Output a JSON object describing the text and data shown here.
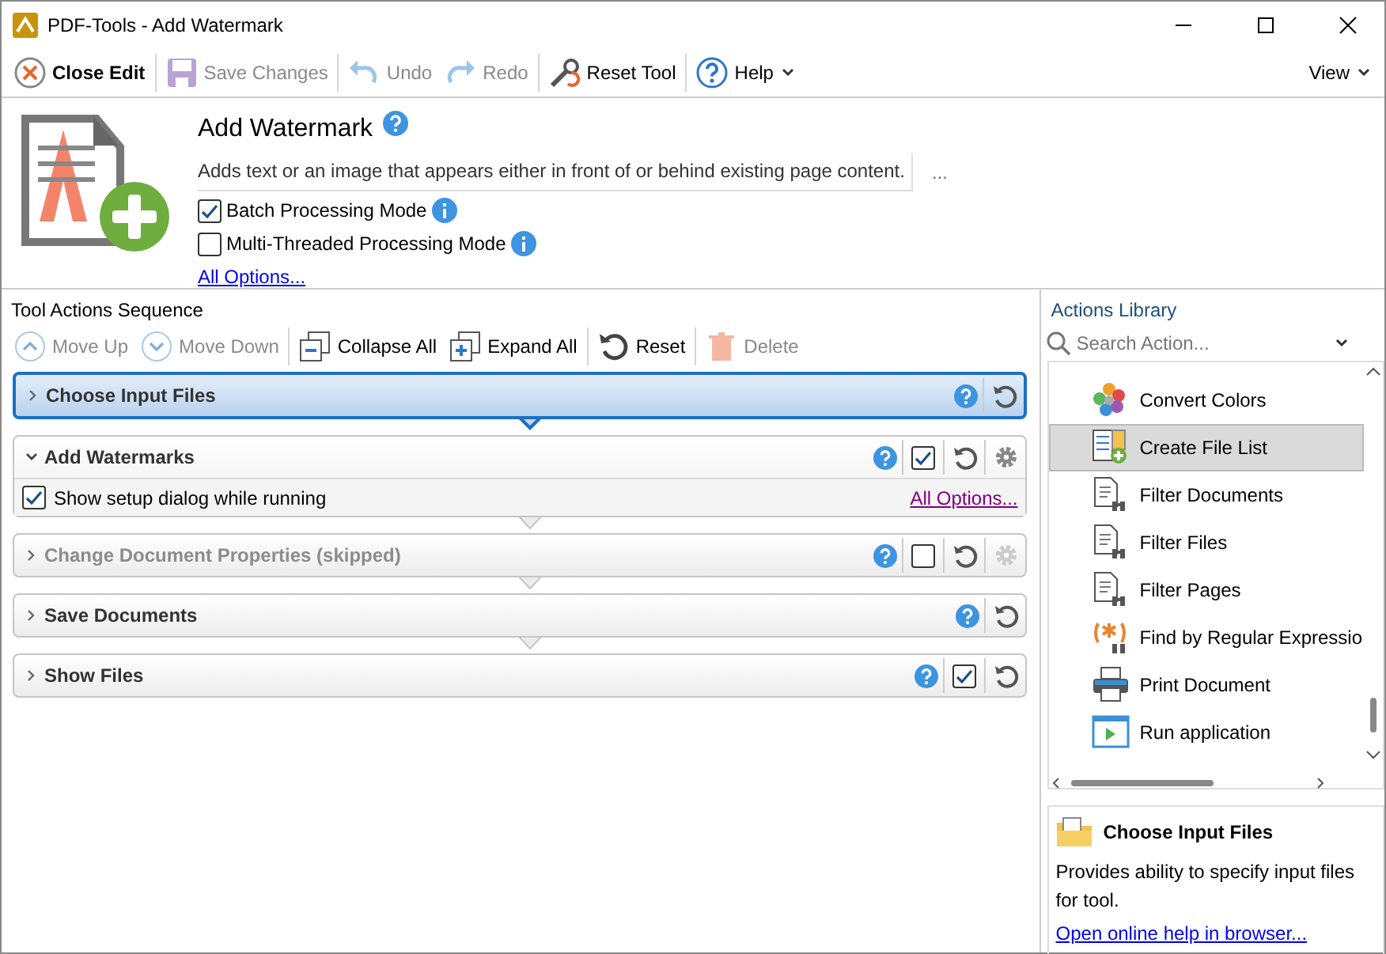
{
  "window": {
    "title": "PDF-Tools - Add Watermark"
  },
  "toolbar": {
    "items": [
      {
        "kind": "close",
        "label": "Close Edit",
        "disabled": false
      },
      {
        "kind": "save",
        "label": "Save Changes",
        "disabled": true
      },
      {
        "kind": "undo",
        "label": "Undo",
        "disabled": true
      },
      {
        "kind": "redo",
        "label": "Redo",
        "disabled": true
      },
      {
        "kind": "reset",
        "label": "Reset Tool",
        "disabled": false
      },
      {
        "kind": "help",
        "label": "Help",
        "disabled": false
      }
    ],
    "view": "View"
  },
  "tool": {
    "title": "Add Watermark",
    "description": "Adds text or an image that appears either in front of or behind existing page content.",
    "more": "...",
    "options": [
      {
        "label": "Batch Processing Mode",
        "checked": true
      },
      {
        "label": "Multi-Threaded Processing Mode",
        "checked": false
      }
    ],
    "all_options": "All Options..."
  },
  "sequence": {
    "title": "Tool Actions Sequence",
    "toolbar": [
      {
        "kind": "up",
        "label": "Move Up",
        "disabled": true
      },
      {
        "kind": "down",
        "label": "Move Down",
        "disabled": true
      },
      {
        "kind": "collapse",
        "label": "Collapse All",
        "disabled": false
      },
      {
        "kind": "expand",
        "label": "Expand All",
        "disabled": false
      },
      {
        "kind": "reset",
        "label": "Reset",
        "disabled": false
      },
      {
        "kind": "delete",
        "label": "Delete",
        "disabled": true
      }
    ],
    "actions": [
      {
        "title": "Choose Input Files",
        "selected": true,
        "expanded": false,
        "skipped": false
      },
      {
        "title": "Add Watermarks",
        "selected": false,
        "expanded": true,
        "skipped": false,
        "checked": true,
        "gear": true,
        "option": {
          "label": "Show setup dialog while running",
          "checked": true
        },
        "link": "All Options..."
      },
      {
        "title": "Change Document Properties (skipped)",
        "selected": false,
        "expanded": false,
        "skipped": true,
        "checked": false,
        "gear": true
      },
      {
        "title": "Save Documents",
        "selected": false,
        "expanded": false,
        "skipped": false
      },
      {
        "title": "Show Files",
        "selected": false,
        "expanded": false,
        "skipped": false,
        "checked": true
      }
    ]
  },
  "library": {
    "title": "Actions Library",
    "search": {
      "placeholder": "Search Action..."
    },
    "items": [
      {
        "kind": "colors",
        "label": "Convert Colors",
        "selected": false
      },
      {
        "kind": "filelist",
        "label": "Create File List",
        "selected": true
      },
      {
        "kind": "filter",
        "label": "Filter Documents",
        "selected": false
      },
      {
        "kind": "filter",
        "label": "Filter Files",
        "selected": false
      },
      {
        "kind": "filter",
        "label": "Filter Pages",
        "selected": false
      },
      {
        "kind": "regex",
        "label": "Find by Regular Expressio",
        "selected": false
      },
      {
        "kind": "print",
        "label": "Print Document",
        "selected": false
      },
      {
        "kind": "run",
        "label": "Run application",
        "selected": false
      }
    ]
  },
  "help_panel": {
    "title": "Choose Input Files",
    "text": "Provides ability to specify input files for tool.",
    "link": "Open online help in browser..."
  }
}
